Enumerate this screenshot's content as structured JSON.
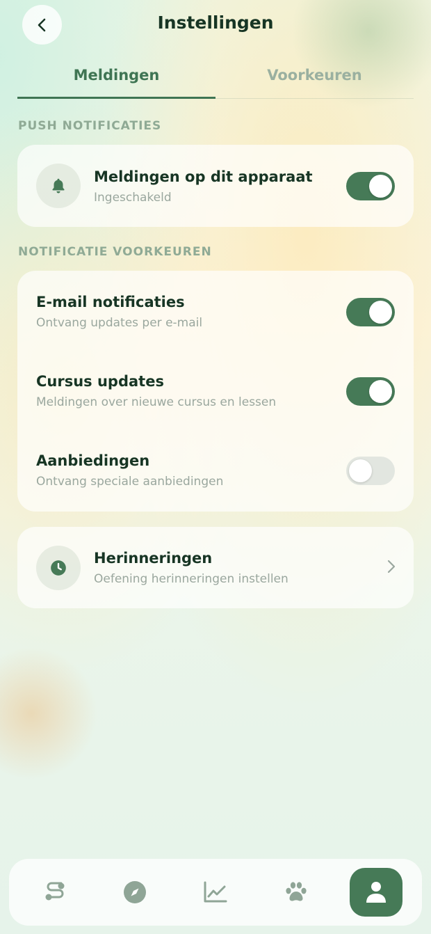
{
  "header": {
    "title": "Instellingen",
    "back_icon": "chevron-left-icon"
  },
  "tabs": [
    {
      "label": "Meldingen",
      "active": true
    },
    {
      "label": "Voorkeuren",
      "active": false
    }
  ],
  "push_section": {
    "label": "PUSH NOTIFICATIES",
    "item": {
      "icon": "bell-icon",
      "title": "Meldingen op dit apparaat",
      "subtitle": "Ingeschakeld",
      "enabled": true
    }
  },
  "prefs_section": {
    "label": "NOTIFICATIE VOORKEUREN",
    "items": [
      {
        "title": "E-mail notificaties",
        "subtitle": "Ontvang updates per e-mail",
        "enabled": true
      },
      {
        "title": "Cursus updates",
        "subtitle": "Meldingen over nieuwe cursus en lessen",
        "enabled": true
      },
      {
        "title": "Aanbiedingen",
        "subtitle": "Ontvang speciale aanbiedingen",
        "enabled": false
      }
    ]
  },
  "reminders": {
    "icon": "clock-icon",
    "title": "Herinneringen",
    "subtitle": "Oefening herinneringen instellen"
  },
  "bottom_nav": [
    {
      "icon": "route-icon",
      "active": false
    },
    {
      "icon": "compass-icon",
      "active": false
    },
    {
      "icon": "chart-line-icon",
      "active": false
    },
    {
      "icon": "paw-icon",
      "active": false
    },
    {
      "icon": "user-icon",
      "active": true
    }
  ],
  "colors": {
    "accent": "#467a57",
    "tab_active": "#3f7553",
    "toggle_off": "#e2e6e0",
    "heading": "#173524",
    "muted": "#9aa79e"
  }
}
